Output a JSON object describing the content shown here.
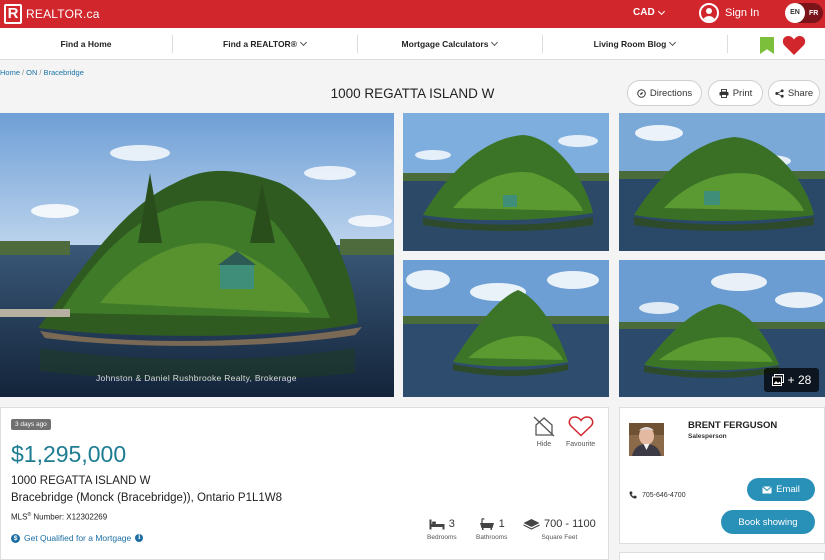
{
  "brand": {
    "logo_letter": "R",
    "name": "REALTOR.ca",
    "accent": "#d0262c"
  },
  "topbar": {
    "currency": "CAD",
    "signin_label": "Sign In",
    "lang_en": "EN",
    "lang_fr": "FR"
  },
  "nav": {
    "items": [
      {
        "label": "Find a Home"
      },
      {
        "label": "Find a REALTOR®"
      },
      {
        "label": "Mortgage Calculators"
      },
      {
        "label": "Living Room Blog"
      }
    ]
  },
  "breadcrumb": [
    "Home",
    "ON",
    "Bracebridge"
  ],
  "listing": {
    "title": "1000 REGATTA ISLAND W",
    "days_badge": "3 days ago",
    "price": "$1,295,000",
    "address_line1": "1000 REGATTA ISLAND W",
    "address_line2": "Bracebridge (Monck (Bracebridge)), Ontario P1L1W8",
    "mls_label": "MLS",
    "mls_sup": "®",
    "mls_suffix": " Number: X12302269",
    "qualify_link": "Get Qualified for a Mortgage",
    "price_color": "#1d7c91"
  },
  "actions": {
    "directions": "Directions",
    "print": "Print",
    "share": "Share",
    "hide": "Hide",
    "favourite": "Favourite"
  },
  "gallery": {
    "watermark": "Johnston & Daniel Rushbrooke Realty, Brokerage",
    "more_count": "+ 28"
  },
  "features": {
    "bedrooms_value": "3",
    "bedrooms_label": "Bedrooms",
    "bathrooms_value": "1",
    "bathrooms_label": "Bathrooms",
    "sqft_value": "700 - 1100",
    "sqft_label": "Square Feet"
  },
  "agent": {
    "name": "BRENT FERGUSON",
    "title": "Salesperson",
    "phone": "705-646-4700",
    "email_label": "Email",
    "book_label": "Book showing",
    "button_color": "#2990b8"
  }
}
